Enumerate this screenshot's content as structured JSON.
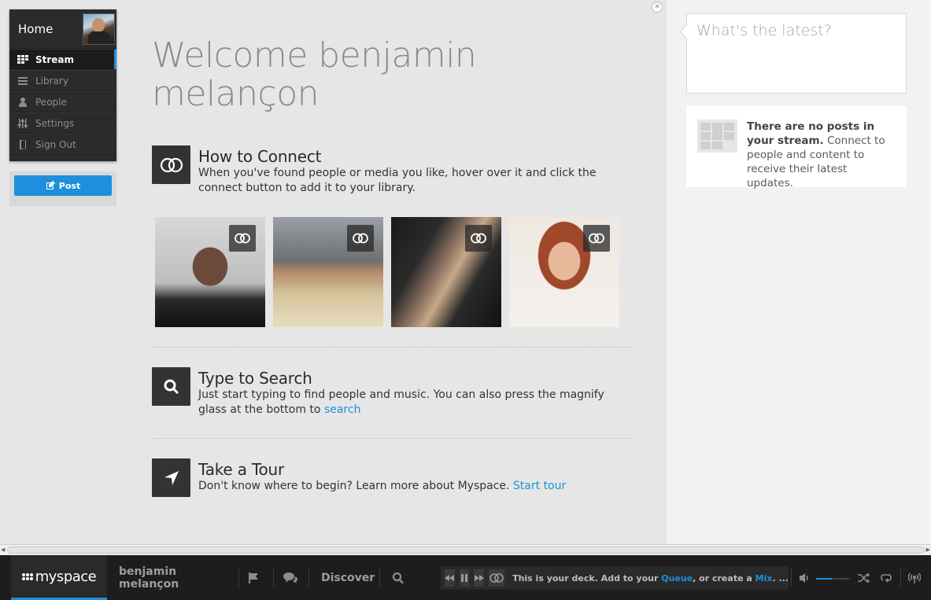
{
  "nav": {
    "home_label": "Home",
    "items": [
      {
        "label": "Stream",
        "icon": "grid-icon",
        "active": true
      },
      {
        "label": "Library",
        "icon": "lines-icon",
        "active": false
      },
      {
        "label": "People",
        "icon": "person-icon",
        "active": false
      },
      {
        "label": "Settings",
        "icon": "sliders-icon",
        "active": false
      },
      {
        "label": "Sign Out",
        "icon": "door-icon",
        "active": false
      }
    ],
    "post_label": "Post"
  },
  "main": {
    "welcome_line1": "Welcome benjamin",
    "welcome_line2": "melançon",
    "connect": {
      "title": "How to Connect",
      "desc": "When you've found people or media you like, hover over it and click the connect button to add it to your library."
    },
    "search": {
      "title": "Type to Search",
      "desc": "Just start typing to find people and music. You can also press the magnify glass at the bottom to ",
      "link": "search"
    },
    "tour": {
      "title": "Take a Tour",
      "desc": "Don't know where to begin? Learn more about Myspace. ",
      "link": "Start tour"
    }
  },
  "right": {
    "latest_placeholder": "What's the latest?",
    "noposts_bold": "There are no posts in your stream.",
    "noposts_text": " Connect to people and content to receive their latest updates."
  },
  "bottom": {
    "logo": "myspace",
    "user": "benjamin melançon",
    "discover": "Discover",
    "deck_prefix": "This is your deck. Add to your ",
    "deck_queue": "Queue",
    "deck_mid": ", or create a ",
    "deck_mix": "Mix",
    "deck_suffix": ". ...",
    "accent": "#1e8fdc"
  }
}
